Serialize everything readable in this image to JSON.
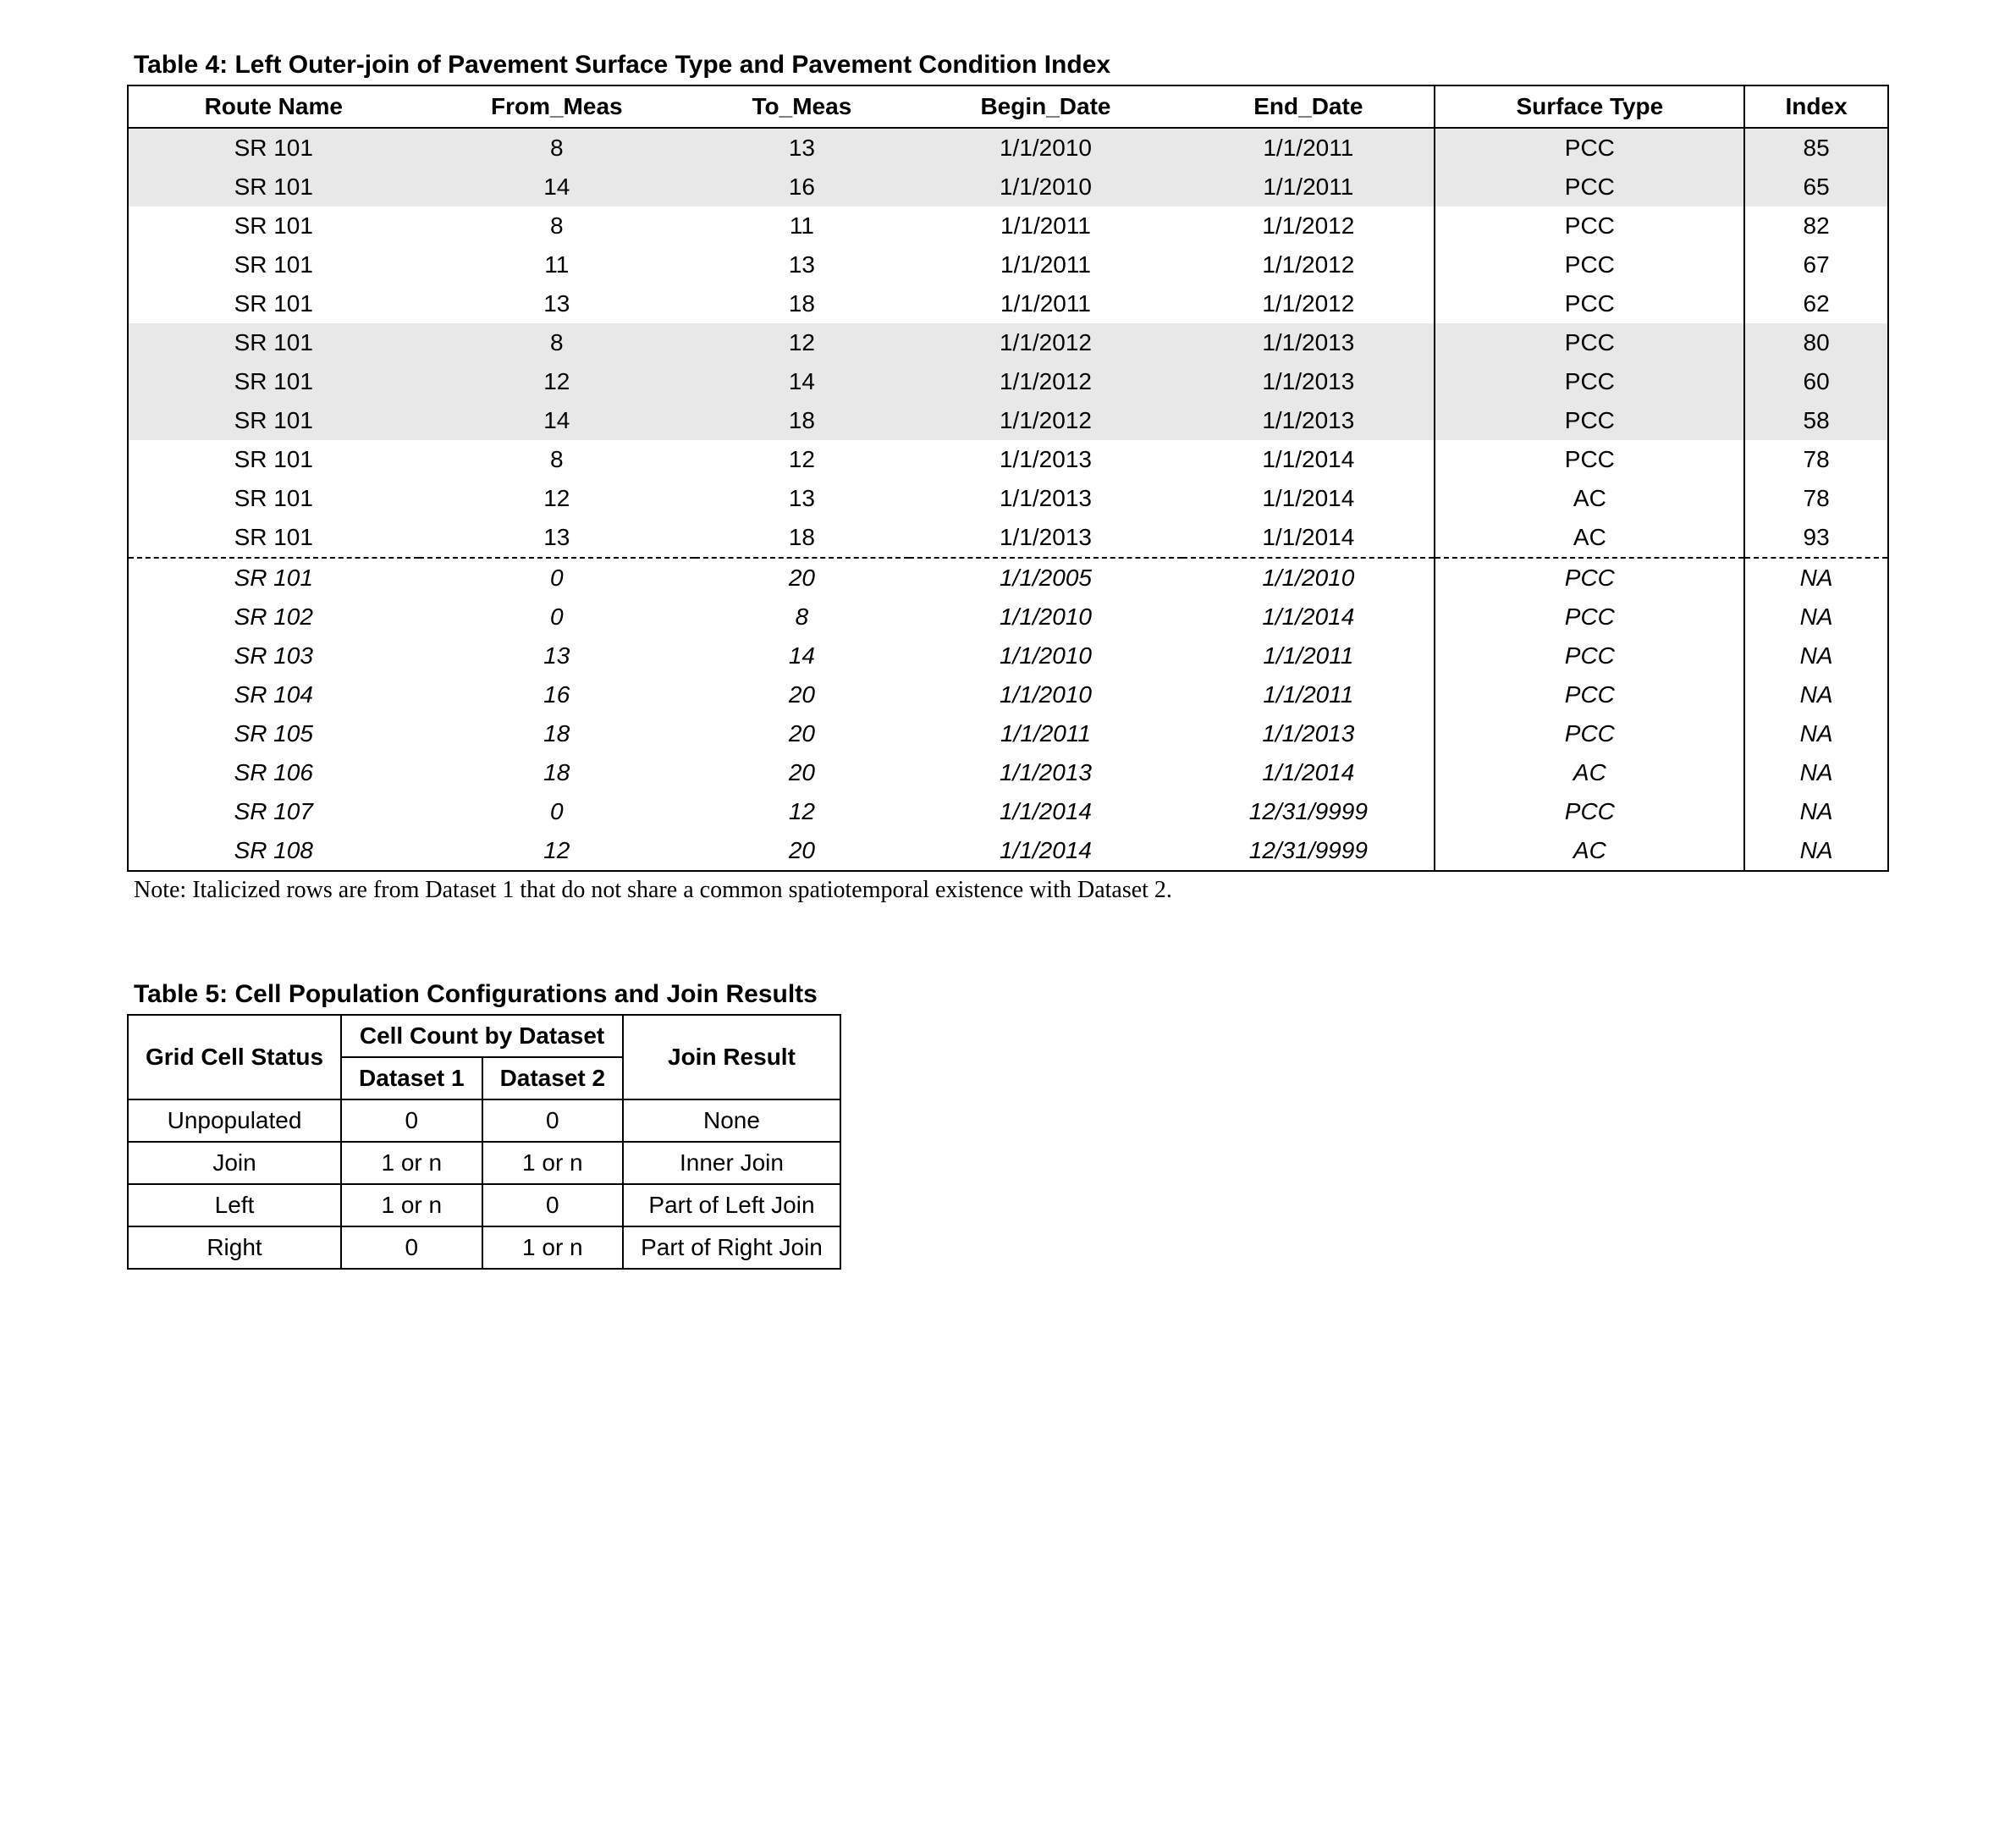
{
  "table4": {
    "title": "Table 4:  Left Outer-join of Pavement Surface Type and Pavement Condition Index",
    "headers": {
      "route": "Route Name",
      "from": "From_Meas",
      "to": "To_Meas",
      "begin": "Begin_Date",
      "end": "End_Date",
      "surface": "Surface Type",
      "index": "Index"
    },
    "rows": [
      {
        "route": "SR 101",
        "from": "8",
        "to": "13",
        "begin": "1/1/2010",
        "end": "1/1/2011",
        "surface": "PCC",
        "index": "85",
        "shaded": true,
        "italic": false,
        "dashed": false
      },
      {
        "route": "SR 101",
        "from": "14",
        "to": "16",
        "begin": "1/1/2010",
        "end": "1/1/2011",
        "surface": "PCC",
        "index": "65",
        "shaded": true,
        "italic": false,
        "dashed": false
      },
      {
        "route": "SR 101",
        "from": "8",
        "to": "11",
        "begin": "1/1/2011",
        "end": "1/1/2012",
        "surface": "PCC",
        "index": "82",
        "shaded": false,
        "italic": false,
        "dashed": false
      },
      {
        "route": "SR 101",
        "from": "11",
        "to": "13",
        "begin": "1/1/2011",
        "end": "1/1/2012",
        "surface": "PCC",
        "index": "67",
        "shaded": false,
        "italic": false,
        "dashed": false
      },
      {
        "route": "SR 101",
        "from": "13",
        "to": "18",
        "begin": "1/1/2011",
        "end": "1/1/2012",
        "surface": "PCC",
        "index": "62",
        "shaded": false,
        "italic": false,
        "dashed": false
      },
      {
        "route": "SR 101",
        "from": "8",
        "to": "12",
        "begin": "1/1/2012",
        "end": "1/1/2013",
        "surface": "PCC",
        "index": "80",
        "shaded": true,
        "italic": false,
        "dashed": false
      },
      {
        "route": "SR 101",
        "from": "12",
        "to": "14",
        "begin": "1/1/2012",
        "end": "1/1/2013",
        "surface": "PCC",
        "index": "60",
        "shaded": true,
        "italic": false,
        "dashed": false
      },
      {
        "route": "SR 101",
        "from": "14",
        "to": "18",
        "begin": "1/1/2012",
        "end": "1/1/2013",
        "surface": "PCC",
        "index": "58",
        "shaded": true,
        "italic": false,
        "dashed": false
      },
      {
        "route": "SR 101",
        "from": "8",
        "to": "12",
        "begin": "1/1/2013",
        "end": "1/1/2014",
        "surface": "PCC",
        "index": "78",
        "shaded": false,
        "italic": false,
        "dashed": false
      },
      {
        "route": "SR 101",
        "from": "12",
        "to": "13",
        "begin": "1/1/2013",
        "end": "1/1/2014",
        "surface": "AC",
        "index": "78",
        "shaded": false,
        "italic": false,
        "dashed": false
      },
      {
        "route": "SR 101",
        "from": "13",
        "to": "18",
        "begin": "1/1/2013",
        "end": "1/1/2014",
        "surface": "AC",
        "index": "93",
        "shaded": false,
        "italic": false,
        "dashed": false
      },
      {
        "route": "SR 101",
        "from": "0",
        "to": "20",
        "begin": "1/1/2005",
        "end": "1/1/2010",
        "surface": "PCC",
        "index": "NA",
        "shaded": false,
        "italic": true,
        "dashed": true
      },
      {
        "route": "SR 102",
        "from": "0",
        "to": "8",
        "begin": "1/1/2010",
        "end": "1/1/2014",
        "surface": "PCC",
        "index": "NA",
        "shaded": false,
        "italic": true,
        "dashed": false
      },
      {
        "route": "SR 103",
        "from": "13",
        "to": "14",
        "begin": "1/1/2010",
        "end": "1/1/2011",
        "surface": "PCC",
        "index": "NA",
        "shaded": false,
        "italic": true,
        "dashed": false
      },
      {
        "route": "SR 104",
        "from": "16",
        "to": "20",
        "begin": "1/1/2010",
        "end": "1/1/2011",
        "surface": "PCC",
        "index": "NA",
        "shaded": false,
        "italic": true,
        "dashed": false
      },
      {
        "route": "SR 105",
        "from": "18",
        "to": "20",
        "begin": "1/1/2011",
        "end": "1/1/2013",
        "surface": "PCC",
        "index": "NA",
        "shaded": false,
        "italic": true,
        "dashed": false
      },
      {
        "route": "SR 106",
        "from": "18",
        "to": "20",
        "begin": "1/1/2013",
        "end": "1/1/2014",
        "surface": "AC",
        "index": "NA",
        "shaded": false,
        "italic": true,
        "dashed": false
      },
      {
        "route": "SR 107",
        "from": "0",
        "to": "12",
        "begin": "1/1/2014",
        "end": "12/31/9999",
        "surface": "PCC",
        "index": "NA",
        "shaded": false,
        "italic": true,
        "dashed": false
      },
      {
        "route": "SR 108",
        "from": "12",
        "to": "20",
        "begin": "1/1/2014",
        "end": "12/31/9999",
        "surface": "AC",
        "index": "NA",
        "shaded": false,
        "italic": true,
        "dashed": false
      }
    ],
    "note": "Note:  Italicized rows are from Dataset 1 that do not share a common spatiotemporal existence with Dataset 2."
  },
  "table5": {
    "title": "Table 5:  Cell Population Configurations and Join Results",
    "headers": {
      "status": "Grid Cell Status",
      "count_span": "Cell Count by Dataset",
      "d1": "Dataset 1",
      "d2": "Dataset 2",
      "result": "Join Result"
    },
    "rows": [
      {
        "status": "Unpopulated",
        "d1": "0",
        "d2": "0",
        "result": "None"
      },
      {
        "status": "Join",
        "d1": "1 or n",
        "d2": "1 or n",
        "result": "Inner Join"
      },
      {
        "status": "Left",
        "d1": "1 or n",
        "d2": "0",
        "result": "Part of Left Join"
      },
      {
        "status": "Right",
        "d1": "0",
        "d2": "1 or n",
        "result": "Part of Right Join"
      }
    ]
  },
  "chart_data": [
    {
      "type": "table",
      "title": "Left Outer-join of Pavement Surface Type and Pavement Condition Index",
      "columns": [
        "Route Name",
        "From_Meas",
        "To_Meas",
        "Begin_Date",
        "End_Date",
        "Surface Type",
        "Index"
      ],
      "rows": [
        [
          "SR 101",
          8,
          13,
          "1/1/2010",
          "1/1/2011",
          "PCC",
          85
        ],
        [
          "SR 101",
          14,
          16,
          "1/1/2010",
          "1/1/2011",
          "PCC",
          65
        ],
        [
          "SR 101",
          8,
          11,
          "1/1/2011",
          "1/1/2012",
          "PCC",
          82
        ],
        [
          "SR 101",
          11,
          13,
          "1/1/2011",
          "1/1/2012",
          "PCC",
          67
        ],
        [
          "SR 101",
          13,
          18,
          "1/1/2011",
          "1/1/2012",
          "PCC",
          62
        ],
        [
          "SR 101",
          8,
          12,
          "1/1/2012",
          "1/1/2013",
          "PCC",
          80
        ],
        [
          "SR 101",
          12,
          14,
          "1/1/2012",
          "1/1/2013",
          "PCC",
          60
        ],
        [
          "SR 101",
          14,
          18,
          "1/1/2012",
          "1/1/2013",
          "PCC",
          58
        ],
        [
          "SR 101",
          8,
          12,
          "1/1/2013",
          "1/1/2014",
          "PCC",
          78
        ],
        [
          "SR 101",
          12,
          13,
          "1/1/2013",
          "1/1/2014",
          "AC",
          78
        ],
        [
          "SR 101",
          13,
          18,
          "1/1/2013",
          "1/1/2014",
          "AC",
          93
        ],
        [
          "SR 101",
          0,
          20,
          "1/1/2005",
          "1/1/2010",
          "PCC",
          "NA"
        ],
        [
          "SR 102",
          0,
          8,
          "1/1/2010",
          "1/1/2014",
          "PCC",
          "NA"
        ],
        [
          "SR 103",
          13,
          14,
          "1/1/2010",
          "1/1/2011",
          "PCC",
          "NA"
        ],
        [
          "SR 104",
          16,
          20,
          "1/1/2010",
          "1/1/2011",
          "PCC",
          "NA"
        ],
        [
          "SR 105",
          18,
          20,
          "1/1/2011",
          "1/1/2013",
          "PCC",
          "NA"
        ],
        [
          "SR 106",
          18,
          20,
          "1/1/2013",
          "1/1/2014",
          "AC",
          "NA"
        ],
        [
          "SR 107",
          0,
          12,
          "1/1/2014",
          "12/31/9999",
          "PCC",
          "NA"
        ],
        [
          "SR 108",
          12,
          20,
          "1/1/2014",
          "12/31/9999",
          "AC",
          "NA"
        ]
      ]
    },
    {
      "type": "table",
      "title": "Cell Population Configurations and Join Results",
      "columns": [
        "Grid Cell Status",
        "Dataset 1",
        "Dataset 2",
        "Join Result"
      ],
      "rows": [
        [
          "Unpopulated",
          "0",
          "0",
          "None"
        ],
        [
          "Join",
          "1 or n",
          "1 or n",
          "Inner Join"
        ],
        [
          "Left",
          "1 or n",
          "0",
          "Part of Left Join"
        ],
        [
          "Right",
          "0",
          "1 or n",
          "Part of Right Join"
        ]
      ]
    }
  ]
}
